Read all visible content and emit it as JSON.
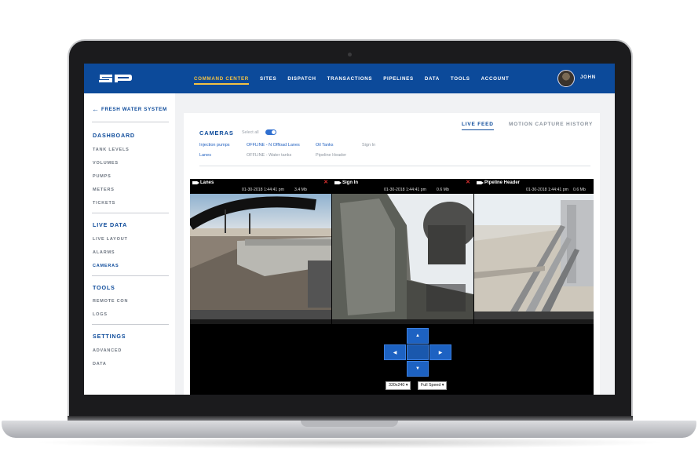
{
  "topbar": {
    "logo_text": "SP",
    "nav": [
      "COMMAND CENTER",
      "SITES",
      "DISPATCH",
      "TRANSACTIONS",
      "PIPELINES",
      "DATA",
      "TOOLS",
      "ACCOUNT"
    ],
    "active_nav": "COMMAND CENTER",
    "user_name": "JOHN"
  },
  "sidebar": {
    "back_label": "FRESH WATER SYSTEM",
    "sections": [
      {
        "title": "DASHBOARD",
        "items": [
          "TANK LEVELS",
          "VOLUMES",
          "PUMPS",
          "METERS",
          "TICKETS"
        ]
      },
      {
        "title": "LIVE DATA",
        "items": [
          "LIVE LAYOUT",
          "ALARMS",
          "CAMERAS"
        ]
      },
      {
        "title": "TOOLS",
        "items": [
          "REMOTE CON",
          "LOGS"
        ]
      },
      {
        "title": "SETTINGS",
        "items": [
          "ADVANCED",
          "DATA"
        ]
      }
    ],
    "active_item": "CAMERAS"
  },
  "main": {
    "title": "CAMERAS",
    "select_all_label": "Select all",
    "tabs": [
      "LIVE FEED",
      "MOTION CAPTURE HISTORY"
    ],
    "camera_links": [
      {
        "label": "Injection pumps",
        "state": "active"
      },
      {
        "label": "OFFLINE - N Offload Lanes",
        "state": "active"
      },
      {
        "label": "Oil Tanks",
        "state": "active"
      },
      {
        "label": "Sign In",
        "state": "inactive"
      },
      {
        "label": "Lanes",
        "state": "active"
      },
      {
        "label": "OFFLINE - Water tanks",
        "state": "inactive"
      },
      {
        "label": "Pipeline Header",
        "state": "inactive"
      }
    ],
    "feeds": [
      {
        "title": "Lanes",
        "time": "01-30-2018 1:44:41 pm",
        "size": "3.4 Mb",
        "closable": true
      },
      {
        "title": "Sign In",
        "time": "01-30-2018 1:44:41 pm",
        "size": "0.6 Mb",
        "closable": true
      },
      {
        "title": "Pipeline Header",
        "time": "01-30-2018 1:44:41 pm",
        "size": "0.6 Mb",
        "closable": false
      }
    ],
    "ptz": {
      "up": "▲",
      "down": "▼",
      "left": "◀",
      "right": "▶",
      "resolution": "320x240",
      "speed": "Full Speed"
    }
  },
  "colors": {
    "brand": "#0c4a9a",
    "accent": "#f3c244",
    "link": "#1f5fbf",
    "ptz": "#1d62c2",
    "close": "#e03030"
  }
}
